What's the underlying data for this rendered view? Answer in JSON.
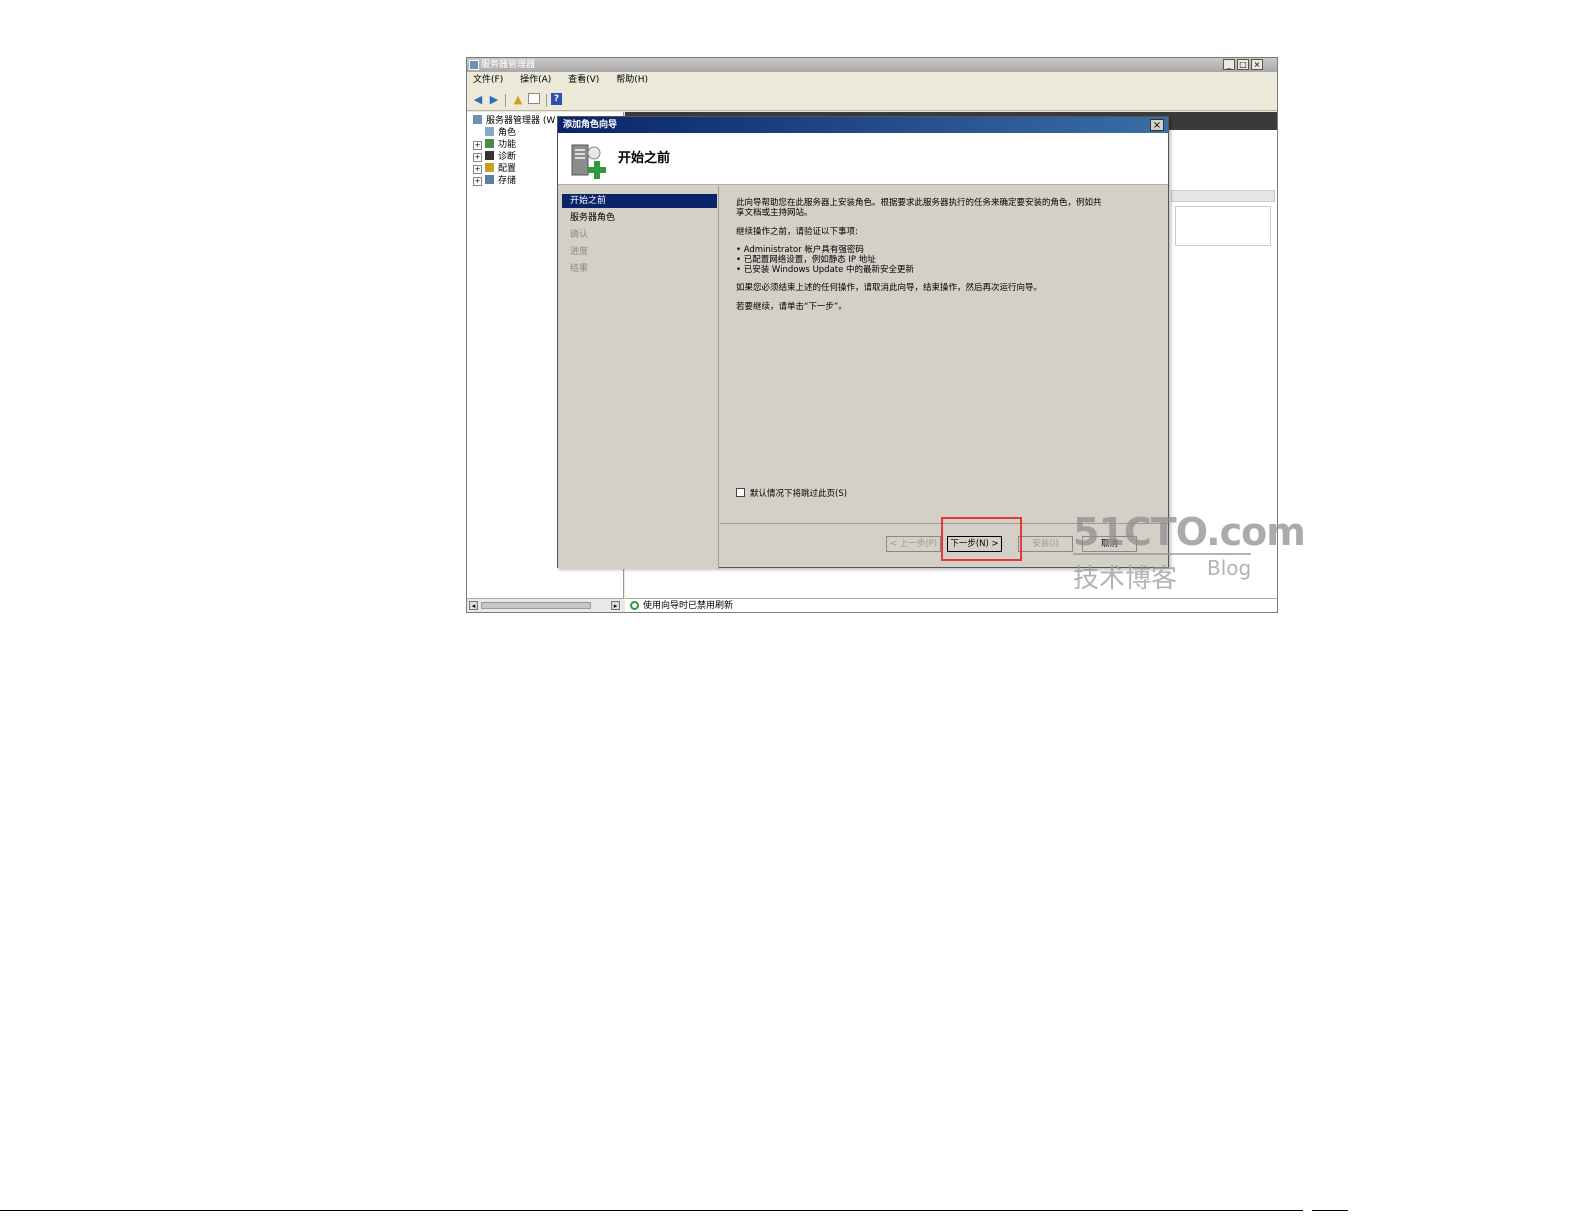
{
  "main_window": {
    "title": "服务器管理器",
    "caption_buttons": {
      "minimize": "_",
      "maximize": "□",
      "close": "×"
    },
    "menu": [
      "文件(F)",
      "操作(A)",
      "查看(V)",
      "帮助(H)"
    ],
    "toolbar_icons": [
      "back-arrow-icon",
      "forward-arrow-icon",
      "up-folder-icon",
      "properties-icon",
      "help-icon"
    ],
    "tree": {
      "root": "服务器管理器 (W",
      "items": [
        "角色",
        "功能",
        "诊断",
        "配置",
        "存储"
      ]
    },
    "status_text": "使用向导时已禁用刷新"
  },
  "wizard": {
    "title": "添加角色向导",
    "close_label": "×",
    "header_title": "开始之前",
    "nav": [
      {
        "label": "开始之前",
        "state": "active"
      },
      {
        "label": "服务器角色",
        "state": "normal"
      },
      {
        "label": "确认",
        "state": "disabled"
      },
      {
        "label": "进度",
        "state": "disabled"
      },
      {
        "label": "结果",
        "state": "disabled"
      }
    ],
    "content": {
      "intro_line1": "此向导帮助您在此服务器上安装角色。根据要求此服务器执行的任务来确定要安装的角色，例如共",
      "intro_line2": "享文档或主持网站。",
      "verify_heading": "继续操作之前，请验证以下事项:",
      "bullets": [
        "• Administrator 帐户具有强密码",
        "• 已配置网络设置，例如静态 IP 地址",
        "• 已安装 Windows Update 中的最新安全更新"
      ],
      "cancel_note": "如果您必须结束上述的任何操作，请取消此向导，结束操作，然后再次运行向导。",
      "continue_note": "若要继续，请单击“下一步”。"
    },
    "skip_checkbox_label": "默认情况下将跳过此页(S)",
    "buttons": {
      "back": "< 上一步(P)",
      "next": "下一步(N) >",
      "install": "安装(I)",
      "cancel": "取消"
    }
  },
  "watermark": {
    "main": "51CTO.com",
    "sub": "技术博客",
    "blog": "Blog"
  },
  "colors": {
    "wizard_title_bar": "#0a246a",
    "nav_active": "#0a246a",
    "highlight_box": "#e03a3a",
    "status_icon": "#2f9a3a"
  }
}
